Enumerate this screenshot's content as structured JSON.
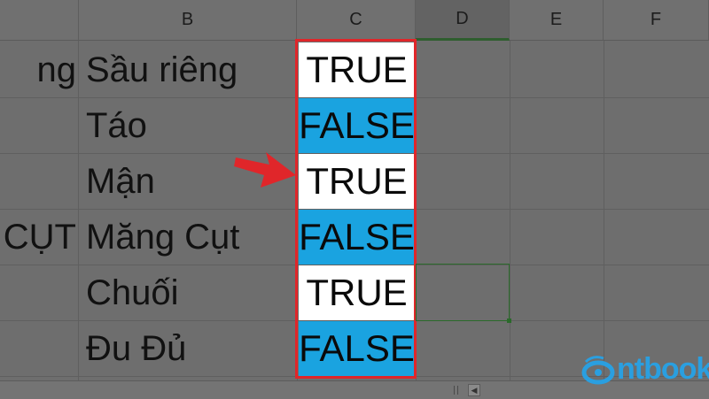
{
  "columns": [
    "B",
    "C",
    "D",
    "E",
    "F"
  ],
  "rows": [
    {
      "a": "ng",
      "b": "Sầu riêng",
      "c": "TRUE"
    },
    {
      "a": "",
      "b": "Táo",
      "c": "FALSE"
    },
    {
      "a": "",
      "b": "Mận",
      "c": "TRUE"
    },
    {
      "a": "CỤT",
      "b": "Măng Cụt",
      "c": "FALSE"
    },
    {
      "a": "",
      "b": "Chuối",
      "c": "TRUE"
    },
    {
      "a": "",
      "b": "Đu Đủ",
      "c": "FALSE"
    }
  ],
  "colors": {
    "true_fill": "#ffffff",
    "false_fill": "#1aa3e0",
    "highlight": "#e0262a",
    "arrow": "#e0262a",
    "logo": "#2a9fe0"
  },
  "annotation": {
    "icon": "arrow-right-icon"
  },
  "logo": {
    "text": "ntbook",
    "icon": "logo-swirl-icon"
  },
  "scroll": {
    "left_icon": "scroll-left-icon"
  }
}
